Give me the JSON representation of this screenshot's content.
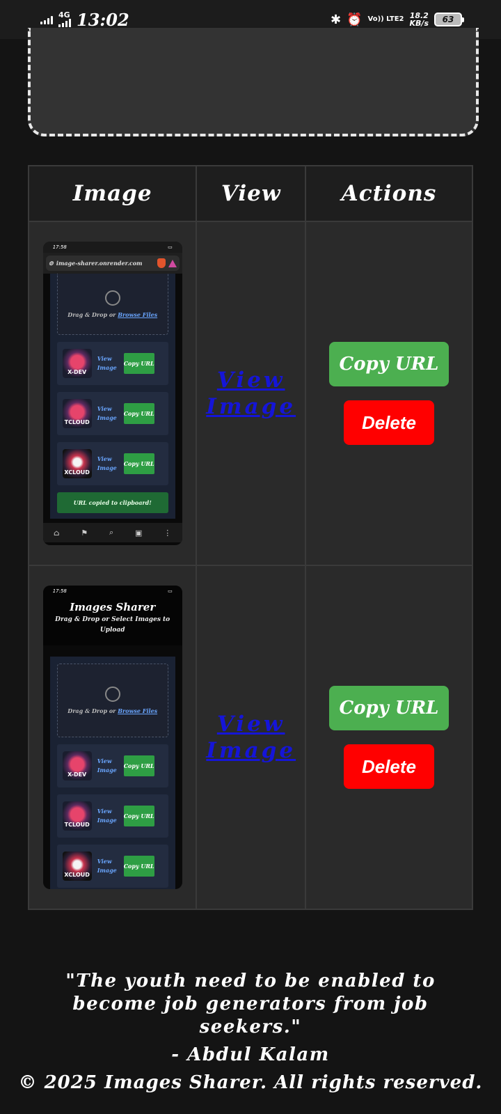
{
  "status_bar": {
    "network": "4G",
    "time": "13:02",
    "volte": "Vo)) LTE2",
    "speed_value": "18.2",
    "speed_unit": "KB/s",
    "battery": "63"
  },
  "table": {
    "headers": [
      "Image",
      "View",
      "Actions"
    ],
    "rows": [
      {
        "view_label": "View Image",
        "copy_label": "Copy URL",
        "delete_label": "Delete",
        "thumbnail": {
          "status_time": "17:58",
          "url": "image-sharer.onrender.com",
          "drop_text": "Drag & Drop or",
          "drop_link": "Browse Files",
          "items": [
            {
              "logo": "X-DEV",
              "view": "View Image",
              "copy": "Copy URL"
            },
            {
              "logo": "TCLOUD",
              "view": "View Image",
              "copy": "Copy URL"
            },
            {
              "logo": "XCLOUD",
              "view": "View Image",
              "copy": "Copy URL"
            }
          ],
          "toast": "URL copied to clipboard!"
        }
      },
      {
        "view_label": "View Image",
        "copy_label": "Copy URL",
        "delete_label": "Delete",
        "thumbnail": {
          "status_time": "17:58",
          "title": "Images Sharer",
          "subtitle": "Drag & Drop or Select Images to Upload",
          "drop_text": "Drag & Drop or",
          "drop_link": "Browse Files",
          "items": [
            {
              "logo": "X-DEV",
              "view": "View Image",
              "copy": "Copy URL"
            },
            {
              "logo": "TCLOUD",
              "view": "View Image",
              "copy": "Copy URL"
            },
            {
              "logo": "XCLOUD",
              "view": "View Image",
              "copy": "Copy URL"
            }
          ]
        }
      }
    ]
  },
  "footer": {
    "quote": "\"The youth need to be enabled to become job generators from job seekers.\"",
    "author": "- Abdul Kalam",
    "copyright": "© 2025 Images Sharer. All rights reserved."
  },
  "colors": {
    "copy_button": "#4caf50",
    "delete_button": "#ff0000",
    "view_link": "#1515d8",
    "background": "#141414"
  }
}
